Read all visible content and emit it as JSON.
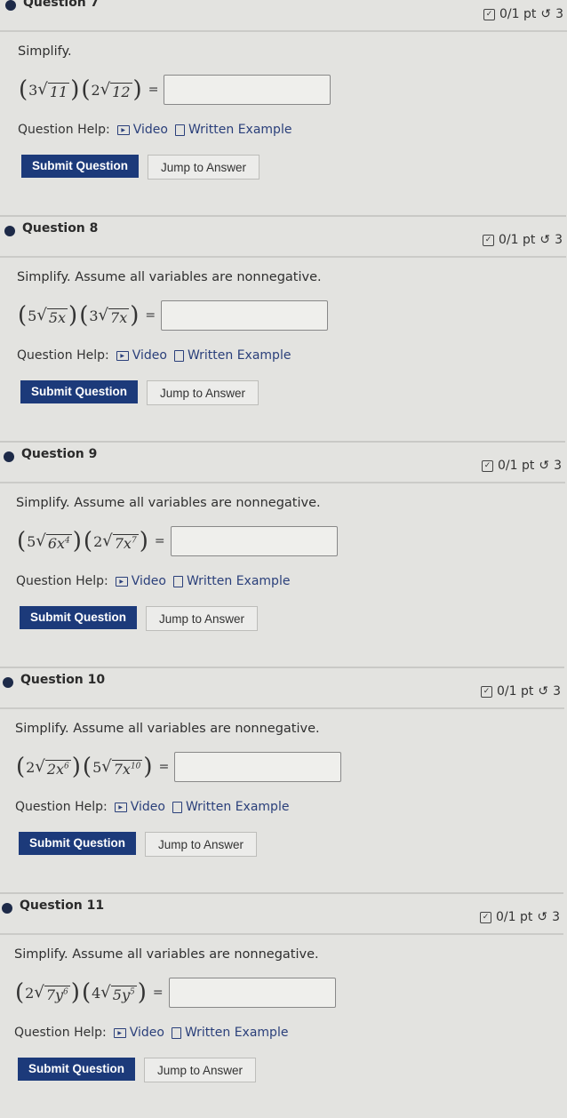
{
  "common": {
    "help_label": "Question Help:",
    "video_label": "Video",
    "written_label": "Written Example",
    "submit_label": "Submit Question",
    "jump_label": "Jump to Answer",
    "points": "0/1 pt",
    "retry": "3"
  },
  "questions": [
    {
      "title": "Question 7",
      "prompt": "Simplify.",
      "a_coef": "3",
      "a_rad": "11",
      "a_exp": "",
      "b_coef": "2",
      "b_rad": "12",
      "b_exp": ""
    },
    {
      "title": "Question 8",
      "prompt": "Simplify. Assume all variables are nonnegative.",
      "a_coef": "5",
      "a_rad": "5x",
      "a_exp": "",
      "b_coef": "3",
      "b_rad": "7x",
      "b_exp": ""
    },
    {
      "title": "Question 9",
      "prompt": "Simplify. Assume all variables are nonnegative.",
      "a_coef": "5",
      "a_rad": "6x",
      "a_exp": "4",
      "b_coef": "2",
      "b_rad": "7x",
      "b_exp": "7"
    },
    {
      "title": "Question 10",
      "prompt": "Simplify. Assume all variables are nonnegative.",
      "a_coef": "2",
      "a_rad": "2x",
      "a_exp": "6",
      "b_coef": "5",
      "b_rad": "7x",
      "b_exp": "10"
    },
    {
      "title": "Question 11",
      "prompt": "Simplify. Assume all variables are nonnegative.",
      "a_coef": "2",
      "a_rad": "7y",
      "a_exp": "6",
      "b_coef": "4",
      "b_rad": "5y",
      "b_exp": "5"
    }
  ],
  "colors": {
    "button": "#1c3a7a",
    "link": "#2a3f7a",
    "bullet": "#1d2a48"
  }
}
